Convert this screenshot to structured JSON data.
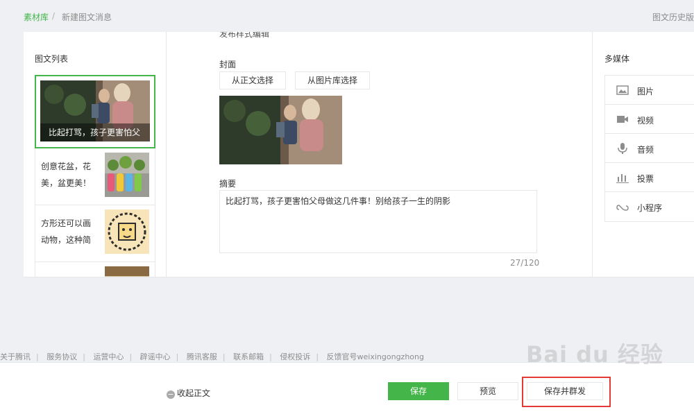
{
  "breadcrumb": {
    "home": "素材库",
    "separator": "/",
    "current": "新建图文消息"
  },
  "history_link": "图文历史版",
  "article_list": {
    "title": "图文列表",
    "first": {
      "caption": "比起打骂，孩子更害怕父"
    },
    "items": [
      {
        "text": "创意花盆，花美，盆更美！"
      },
      {
        "text": "方形还可以画动物，这种简"
      },
      {
        "text": ""
      }
    ]
  },
  "editor": {
    "partial_heading": "发布样式编辑",
    "cover_label": "封面",
    "select_from_body": "从正文选择",
    "select_from_library": "从图片库选择",
    "summary_label": "摘要",
    "summary_value": "比起打骂，孩子更害怕父母做这几件事！别给孩子一生的阴影",
    "counter": "27/120"
  },
  "media": {
    "title": "多媒体",
    "items": [
      {
        "label": "图片",
        "icon": "image-icon"
      },
      {
        "label": "视频",
        "icon": "video-icon"
      },
      {
        "label": "音频",
        "icon": "microphone-icon"
      },
      {
        "label": "投票",
        "icon": "poll-icon"
      },
      {
        "label": "小程序",
        "icon": "mini-program-icon"
      }
    ]
  },
  "footer_links": [
    "关于腾讯",
    "服务协议",
    "运营中心",
    "辟谣中心",
    "腾讯客服",
    "联系邮箱",
    "侵权投诉",
    "反馈官号weixingongzhong"
  ],
  "bottom_bar": {
    "collapse_label": "收起正文",
    "save_label": "保存",
    "preview_label": "预览",
    "save_send_label": "保存并群发"
  },
  "watermark": "Bai du 经验",
  "colors": {
    "accent": "#44b549",
    "highlight": "#e53935"
  }
}
